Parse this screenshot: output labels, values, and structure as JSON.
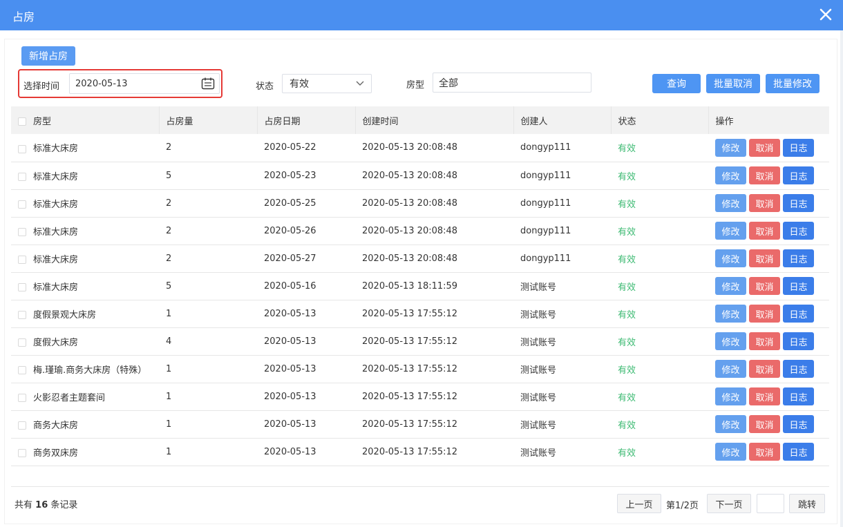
{
  "dialog": {
    "title": "占房"
  },
  "toolbar": {
    "new_label": "新增占房",
    "date_label": "选择时间",
    "date_value": "2020-05-13",
    "status_label": "状态",
    "status_value": "有效",
    "roomtype_label": "房型",
    "roomtype_value": "全部",
    "query_label": "查询",
    "batch_cancel_label": "批量取消",
    "batch_edit_label": "批量修改"
  },
  "table": {
    "headers": [
      "房型",
      "占房量",
      "占房日期",
      "创建时间",
      "创建人",
      "状态",
      "操作"
    ],
    "actions": {
      "edit": "修改",
      "cancel": "取消",
      "log": "日志"
    },
    "rows": [
      [
        "标准大床房",
        "2",
        "2020-05-22",
        "2020-05-13 20:08:48",
        "dongyp111",
        "有效"
      ],
      [
        "标准大床房",
        "5",
        "2020-05-23",
        "2020-05-13 20:08:48",
        "dongyp111",
        "有效"
      ],
      [
        "标准大床房",
        "2",
        "2020-05-25",
        "2020-05-13 20:08:48",
        "dongyp111",
        "有效"
      ],
      [
        "标准大床房",
        "2",
        "2020-05-26",
        "2020-05-13 20:08:48",
        "dongyp111",
        "有效"
      ],
      [
        "标准大床房",
        "2",
        "2020-05-27",
        "2020-05-13 20:08:48",
        "dongyp111",
        "有效"
      ],
      [
        "标准大床房",
        "5",
        "2020-05-16",
        "2020-05-13 18:11:59",
        "测试账号",
        "有效"
      ],
      [
        "度假景观大床房",
        "1",
        "2020-05-13",
        "2020-05-13 17:55:12",
        "测试账号",
        "有效"
      ],
      [
        "度假大床房",
        "4",
        "2020-05-13",
        "2020-05-13 17:55:12",
        "测试账号",
        "有效"
      ],
      [
        "梅.瑾瑜.商务大床房（特殊）",
        "1",
        "2020-05-13",
        "2020-05-13 17:55:12",
        "测试账号",
        "有效"
      ],
      [
        "火影忍者主题套间",
        "1",
        "2020-05-13",
        "2020-05-13 17:55:12",
        "测试账号",
        "有效"
      ],
      [
        "商务大床房",
        "1",
        "2020-05-13",
        "2020-05-13 17:55:12",
        "测试账号",
        "有效"
      ],
      [
        "商务双床房",
        "1",
        "2020-05-13",
        "2020-05-13 17:55:12",
        "测试账号",
        "有效"
      ]
    ]
  },
  "footer": {
    "total_prefix": "共有",
    "total_count": "16",
    "total_suffix": "条记录",
    "prev_label": "上一页",
    "page_info": "第1/2页",
    "next_label": "下一页",
    "jump_label": "跳转"
  }
}
